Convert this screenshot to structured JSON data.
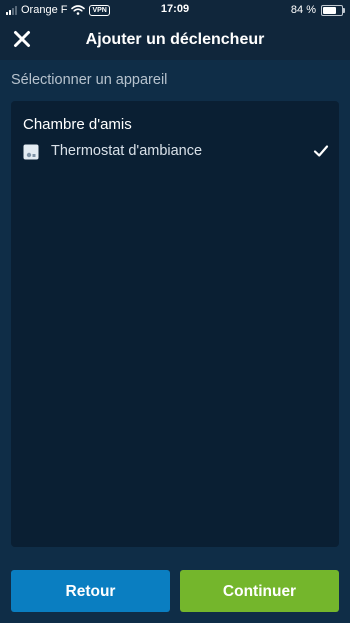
{
  "status_bar": {
    "carrier": "Orange F",
    "vpn": "VPN",
    "time": "17:09",
    "battery_percent_text": "84 %",
    "battery_level": 0.84,
    "signal_bars": 2
  },
  "header": {
    "close_icon": "close-icon",
    "title": "Ajouter un déclencheur"
  },
  "main": {
    "section_label": "Sélectionner un appareil",
    "rooms": [
      {
        "name": "Chambre d'amis",
        "devices": [
          {
            "label": "Thermostat d'ambiance",
            "icon": "thermostat-icon",
            "selected": true
          }
        ]
      }
    ]
  },
  "footer": {
    "back_label": "Retour",
    "continue_label": "Continuer"
  },
  "colors": {
    "background": "#0f2d47",
    "header": "#10263b",
    "panel": "#0a1f33",
    "back_button": "#0a7ec1",
    "continue_button": "#74b62c"
  }
}
